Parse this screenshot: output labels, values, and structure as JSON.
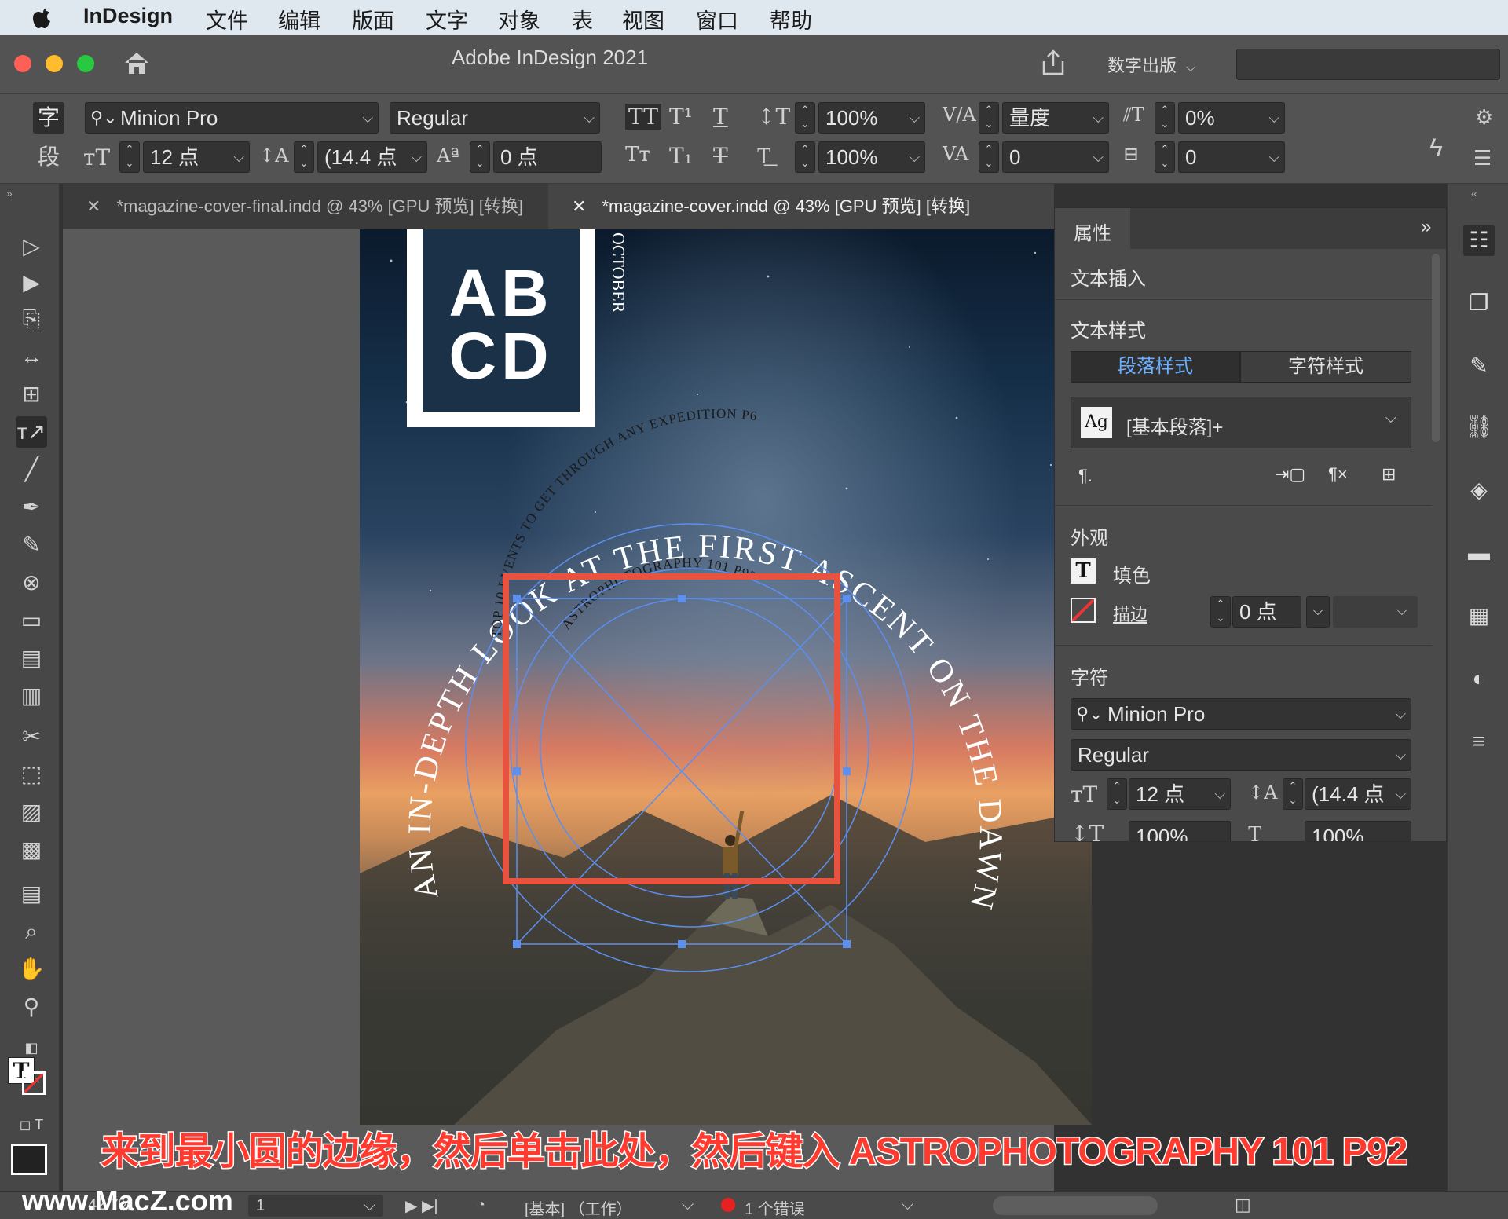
{
  "menubar": {
    "app": "InDesign",
    "items": [
      "文件",
      "编辑",
      "版面",
      "文字",
      "对象",
      "表",
      "视图",
      "窗口",
      "帮助"
    ]
  },
  "window": {
    "title": "Adobe InDesign 2021",
    "workspace": "数字出版"
  },
  "control": {
    "mode_char": "字",
    "mode_para": "段",
    "font_family": "Minion Pro",
    "font_style": "Regular",
    "font_size": "12 点",
    "leading": "(14.4 点",
    "baseline": "0 点",
    "vscale": "100%",
    "hscale": "100%",
    "kerning": "量度",
    "tracking": "0",
    "skew": "0%",
    "rotate": "0"
  },
  "tabs": [
    {
      "label": "*magazine-cover-final.indd @ 43% [GPU 预览] [转换]"
    },
    {
      "label": "*magazine-cover.indd @ 43% [GPU 预览] [转换]"
    }
  ],
  "cover": {
    "logo_line1": "AB",
    "logo_line2": "CD",
    "month": "OCTOBER",
    "outer_arc": "AN IN-DEPTH LOOK AT THE FIRST ASCENT ON THE DAWN WALL P38",
    "middle_arc": "TOP 10 EVENTS TO GET THROUGH ANY EXPEDITION P6",
    "inner_arc": "ASTROPHOTOGRAPHY 101 P92"
  },
  "panel": {
    "tab": "属性",
    "text_insert": "文本插入",
    "text_styles": "文本样式",
    "para_styles": "段落样式",
    "char_styles": "字符样式",
    "style_preview": "Ag",
    "style_value": "[基本段落]+",
    "appearance": "外观",
    "fill": "填色",
    "stroke": "描边",
    "stroke_weight": "0 点",
    "character": "字符",
    "font_family": "Minion Pro",
    "font_style": "Regular",
    "font_size": "12 点",
    "leading": "(14.4 点",
    "vscale": "100%",
    "hscale": "100%"
  },
  "status": {
    "zoom": "42.7%",
    "page": "1",
    "style": "[基本] （工作）",
    "errors": "1 个错误"
  },
  "caption": "来到最小圆的边缘，然后单击此处，然后键入 ASTROPHOTOGRAPHY 101 P92",
  "watermark": "www.MacZ.com",
  "colors": {
    "highlight": "#e8533f",
    "selection": "#5b8ff0",
    "caption_red": "#ff3b2f"
  }
}
